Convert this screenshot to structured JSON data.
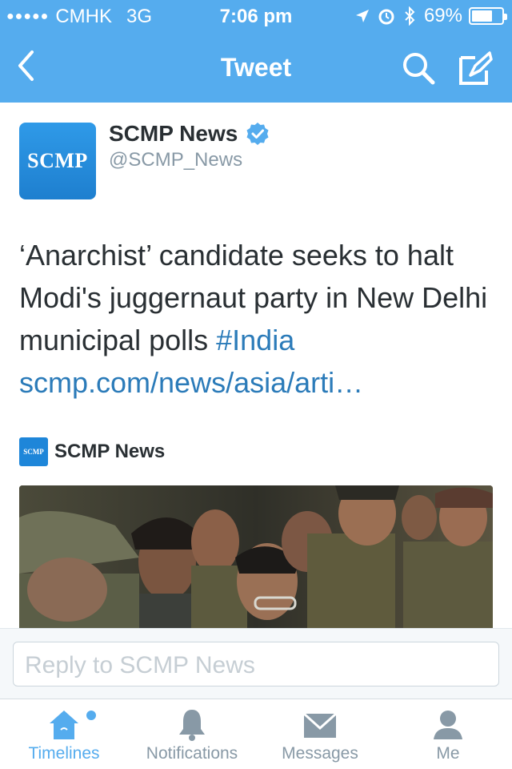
{
  "status_bar": {
    "signal": "●●●●●",
    "carrier": "CMHK",
    "network": "3G",
    "time": "7:06 pm",
    "battery": "69%",
    "battery_level": 0.69
  },
  "nav": {
    "title": "Tweet"
  },
  "tweet": {
    "avatar_text": "SCMP",
    "author_name": "SCMP News",
    "author_handle": "@SCMP_News",
    "text_main": "‘Anarchist’ candidate seeks to halt Modi's juggernaut party in New Delhi municipal polls ",
    "hashtag": "#India",
    "link": "scmp.com/news/asia/arti…"
  },
  "card": {
    "logo_text": "SCMP",
    "source": "SCMP News"
  },
  "reply": {
    "placeholder": "Reply to SCMP News"
  },
  "tabs": [
    {
      "label": "Timelines",
      "icon": "home-icon",
      "active": true
    },
    {
      "label": "Notifications",
      "icon": "bell-icon",
      "active": false
    },
    {
      "label": "Messages",
      "icon": "envelope-icon",
      "active": false
    },
    {
      "label": "Me",
      "icon": "person-icon",
      "active": false
    }
  ],
  "colors": {
    "brand": "#55acee",
    "link": "#2b7bb9",
    "text": "#292f33",
    "muted": "#8899a6"
  }
}
